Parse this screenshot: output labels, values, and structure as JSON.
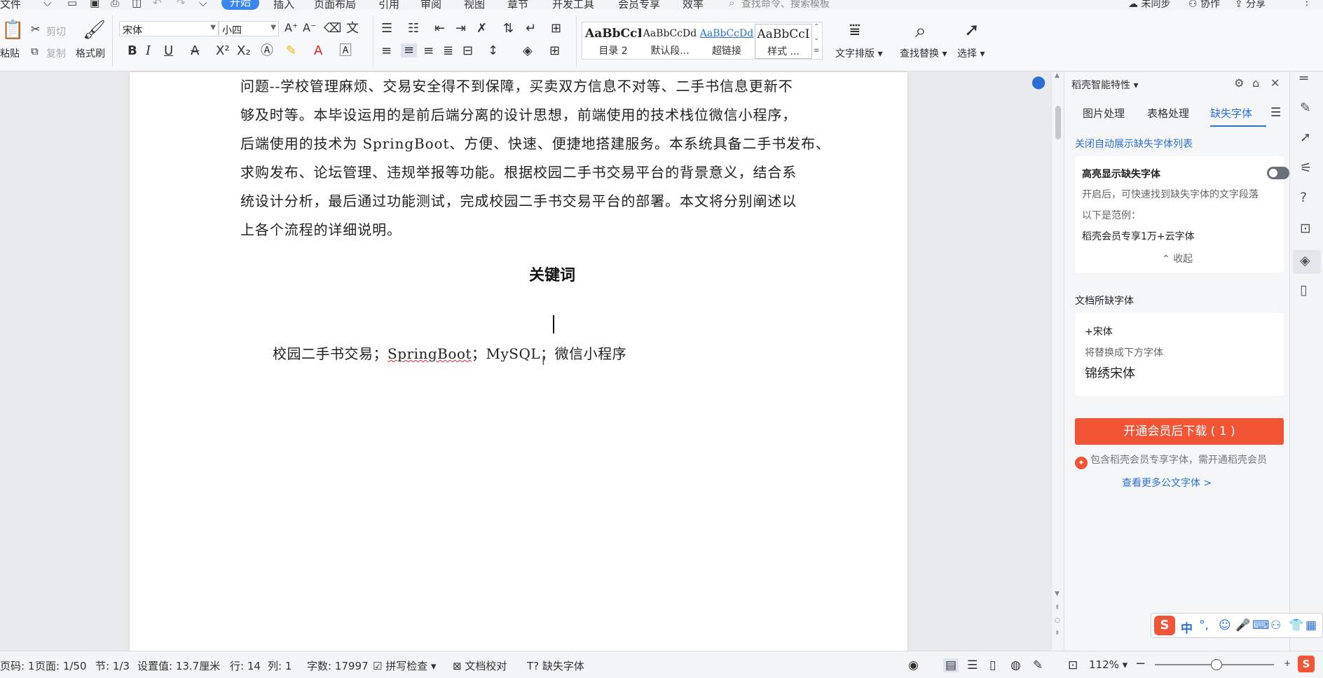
{
  "menu": {
    "file": "文件",
    "tabs": [
      "开始",
      "插入",
      "页面布局",
      "引用",
      "审阅",
      "视图",
      "章节",
      "开发工具",
      "会员专享",
      "效率"
    ],
    "search_placeholder": "查找命令、搜索模板",
    "sync": "未同步",
    "collab": "协作",
    "share": "分享"
  },
  "ribbon": {
    "paste": "粘贴",
    "cut": "剪切",
    "copy": "复制",
    "format_painter": "格式刷",
    "font": "宋体",
    "size": "小四",
    "styles": [
      {
        "sample": "AaBbCcI",
        "label": "目录 2"
      },
      {
        "sample": "AaBbCcDd",
        "label": "默认段..."
      },
      {
        "sample": "AaBbCcDd",
        "label": "超链接"
      },
      {
        "sample": "AaBbCcI",
        "label": "样式 ..."
      }
    ],
    "text_layout": "文字排版",
    "find_replace": "查找替换",
    "select": "选择"
  },
  "doc": {
    "paragraph": [
      "问题--学校管理麻烦、交易安全得不到保障，买卖双方信息不对等、二手书信息更新不",
      "够及时等。本毕设运用的是前后端分离的设计思想，前端使用的技术栈位微信小程序，",
      "后端使用的技术为 SpringBoot、方便、快速、便捷地搭建服务。本系统具备二手书发布、",
      "求购发布、论坛管理、违规举报等功能。根据校园二手书交易平台的背景意义，结合系",
      "统设计分析，最后通过功能测试，完成校园二手书交易平台的部署。本文将分别阐述以",
      "上各个流程的详细说明。"
    ],
    "keywords_title": "关键词",
    "keywords": {
      "k1": "校园二手书交易；",
      "k2": "SpringBoot",
      "k3": "；MySQL；",
      "k4": "微信小程序"
    }
  },
  "pane": {
    "title": "稻壳智能特性",
    "tabs": [
      "图片处理",
      "表格处理",
      "缺失字体"
    ],
    "close_auto": "关闭自动展示缺失字体列表",
    "highlight_title": "高亮显示缺失字体",
    "highlight_desc": "开启后，可快速找到缺失字体的文字段落",
    "example_label": "以下是范例：",
    "example": "稻壳会员专享1万+云字体",
    "collapse": "收起",
    "missing_title": "文档所缺字体",
    "missing_font": "+宋体",
    "replace_hint": "将替换成下方字体",
    "replace_font": "锦绣宋体",
    "download_btn": "开通会员后下载 ( 1 )",
    "note": "包含稻壳会员专享字体，需开通稻壳会员",
    "more_link": "查看更多公文字体 >"
  },
  "status": {
    "pagenum": "页码: 1",
    "page": "页面: 1/50",
    "section": "节: 1/3",
    "setting": "设置值: 13.7厘米",
    "row": "行: 14",
    "col": "列: 1",
    "wordcount": "字数: 17997",
    "spell": "拼写检查",
    "proof": "文档校对",
    "missing_font": "缺失字体",
    "zoom": "112%"
  },
  "ime": {
    "logo": "S",
    "mode": "中"
  },
  "colors": {
    "accent": "#3a86f0",
    "link": "#2b6fd6",
    "download": "#f25536"
  }
}
